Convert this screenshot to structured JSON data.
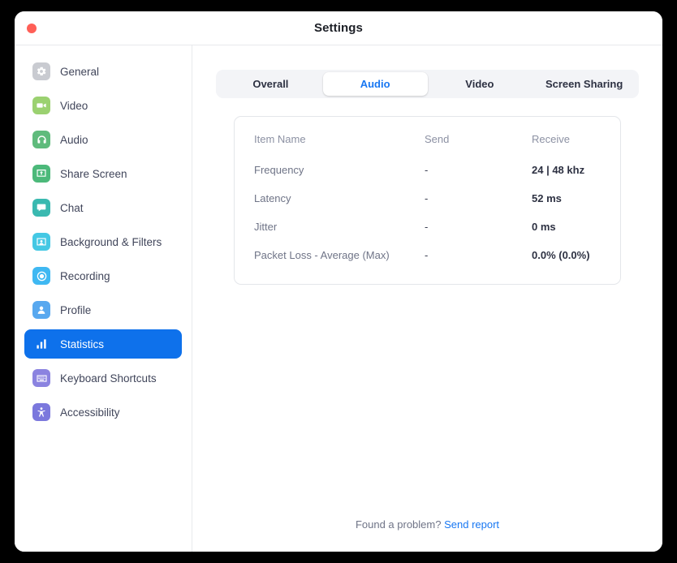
{
  "window": {
    "title": "Settings",
    "close_button": "close"
  },
  "sidebar": {
    "items": [
      {
        "label": "General",
        "icon": "gear-icon",
        "color": "#c9cbd1",
        "active": false
      },
      {
        "label": "Video",
        "icon": "camcorder-icon",
        "color": "#9bd170",
        "active": false
      },
      {
        "label": "Audio",
        "icon": "headphones-icon",
        "color": "#5fbb7c",
        "active": false
      },
      {
        "label": "Share Screen",
        "icon": "share-screen-icon",
        "color": "#4cb97a",
        "active": false
      },
      {
        "label": "Chat",
        "icon": "chat-bubble-icon",
        "color": "#3ab9b0",
        "active": false
      },
      {
        "label": "Background & Filters",
        "icon": "person-frame-icon",
        "color": "#44c8e4",
        "active": false
      },
      {
        "label": "Recording",
        "icon": "record-circle-icon",
        "color": "#3fb8f2",
        "active": false
      },
      {
        "label": "Profile",
        "icon": "person-icon",
        "color": "#58a8ef",
        "active": false
      },
      {
        "label": "Statistics",
        "icon": "bar-chart-icon",
        "color": "#0e71eb",
        "active": true
      },
      {
        "label": "Keyboard Shortcuts",
        "icon": "keyboard-icon",
        "color": "#8b83e0",
        "active": false
      },
      {
        "label": "Accessibility",
        "icon": "accessibility-icon",
        "color": "#7b78dd",
        "active": false
      }
    ]
  },
  "tabs": [
    {
      "label": "Overall",
      "active": false
    },
    {
      "label": "Audio",
      "active": true
    },
    {
      "label": "Video",
      "active": false
    },
    {
      "label": "Screen Sharing",
      "active": false
    }
  ],
  "stats": {
    "columns": [
      "Item Name",
      "Send",
      "Receive"
    ],
    "rows": [
      {
        "name": "Frequency",
        "send": "-",
        "receive": "24 | 48 khz"
      },
      {
        "name": "Latency",
        "send": "-",
        "receive": "52 ms"
      },
      {
        "name": "Jitter",
        "send": "-",
        "receive": "0 ms"
      },
      {
        "name": "Packet Loss - Average (Max)",
        "send": "-",
        "receive": "0.0% (0.0%)"
      }
    ]
  },
  "footer": {
    "text": "Found a problem?",
    "link": "Send report"
  },
  "colors": {
    "accent": "#0e71eb",
    "link": "#1877f2",
    "close": "#ff5f57",
    "tabbar_bg": "#f3f4f7"
  }
}
